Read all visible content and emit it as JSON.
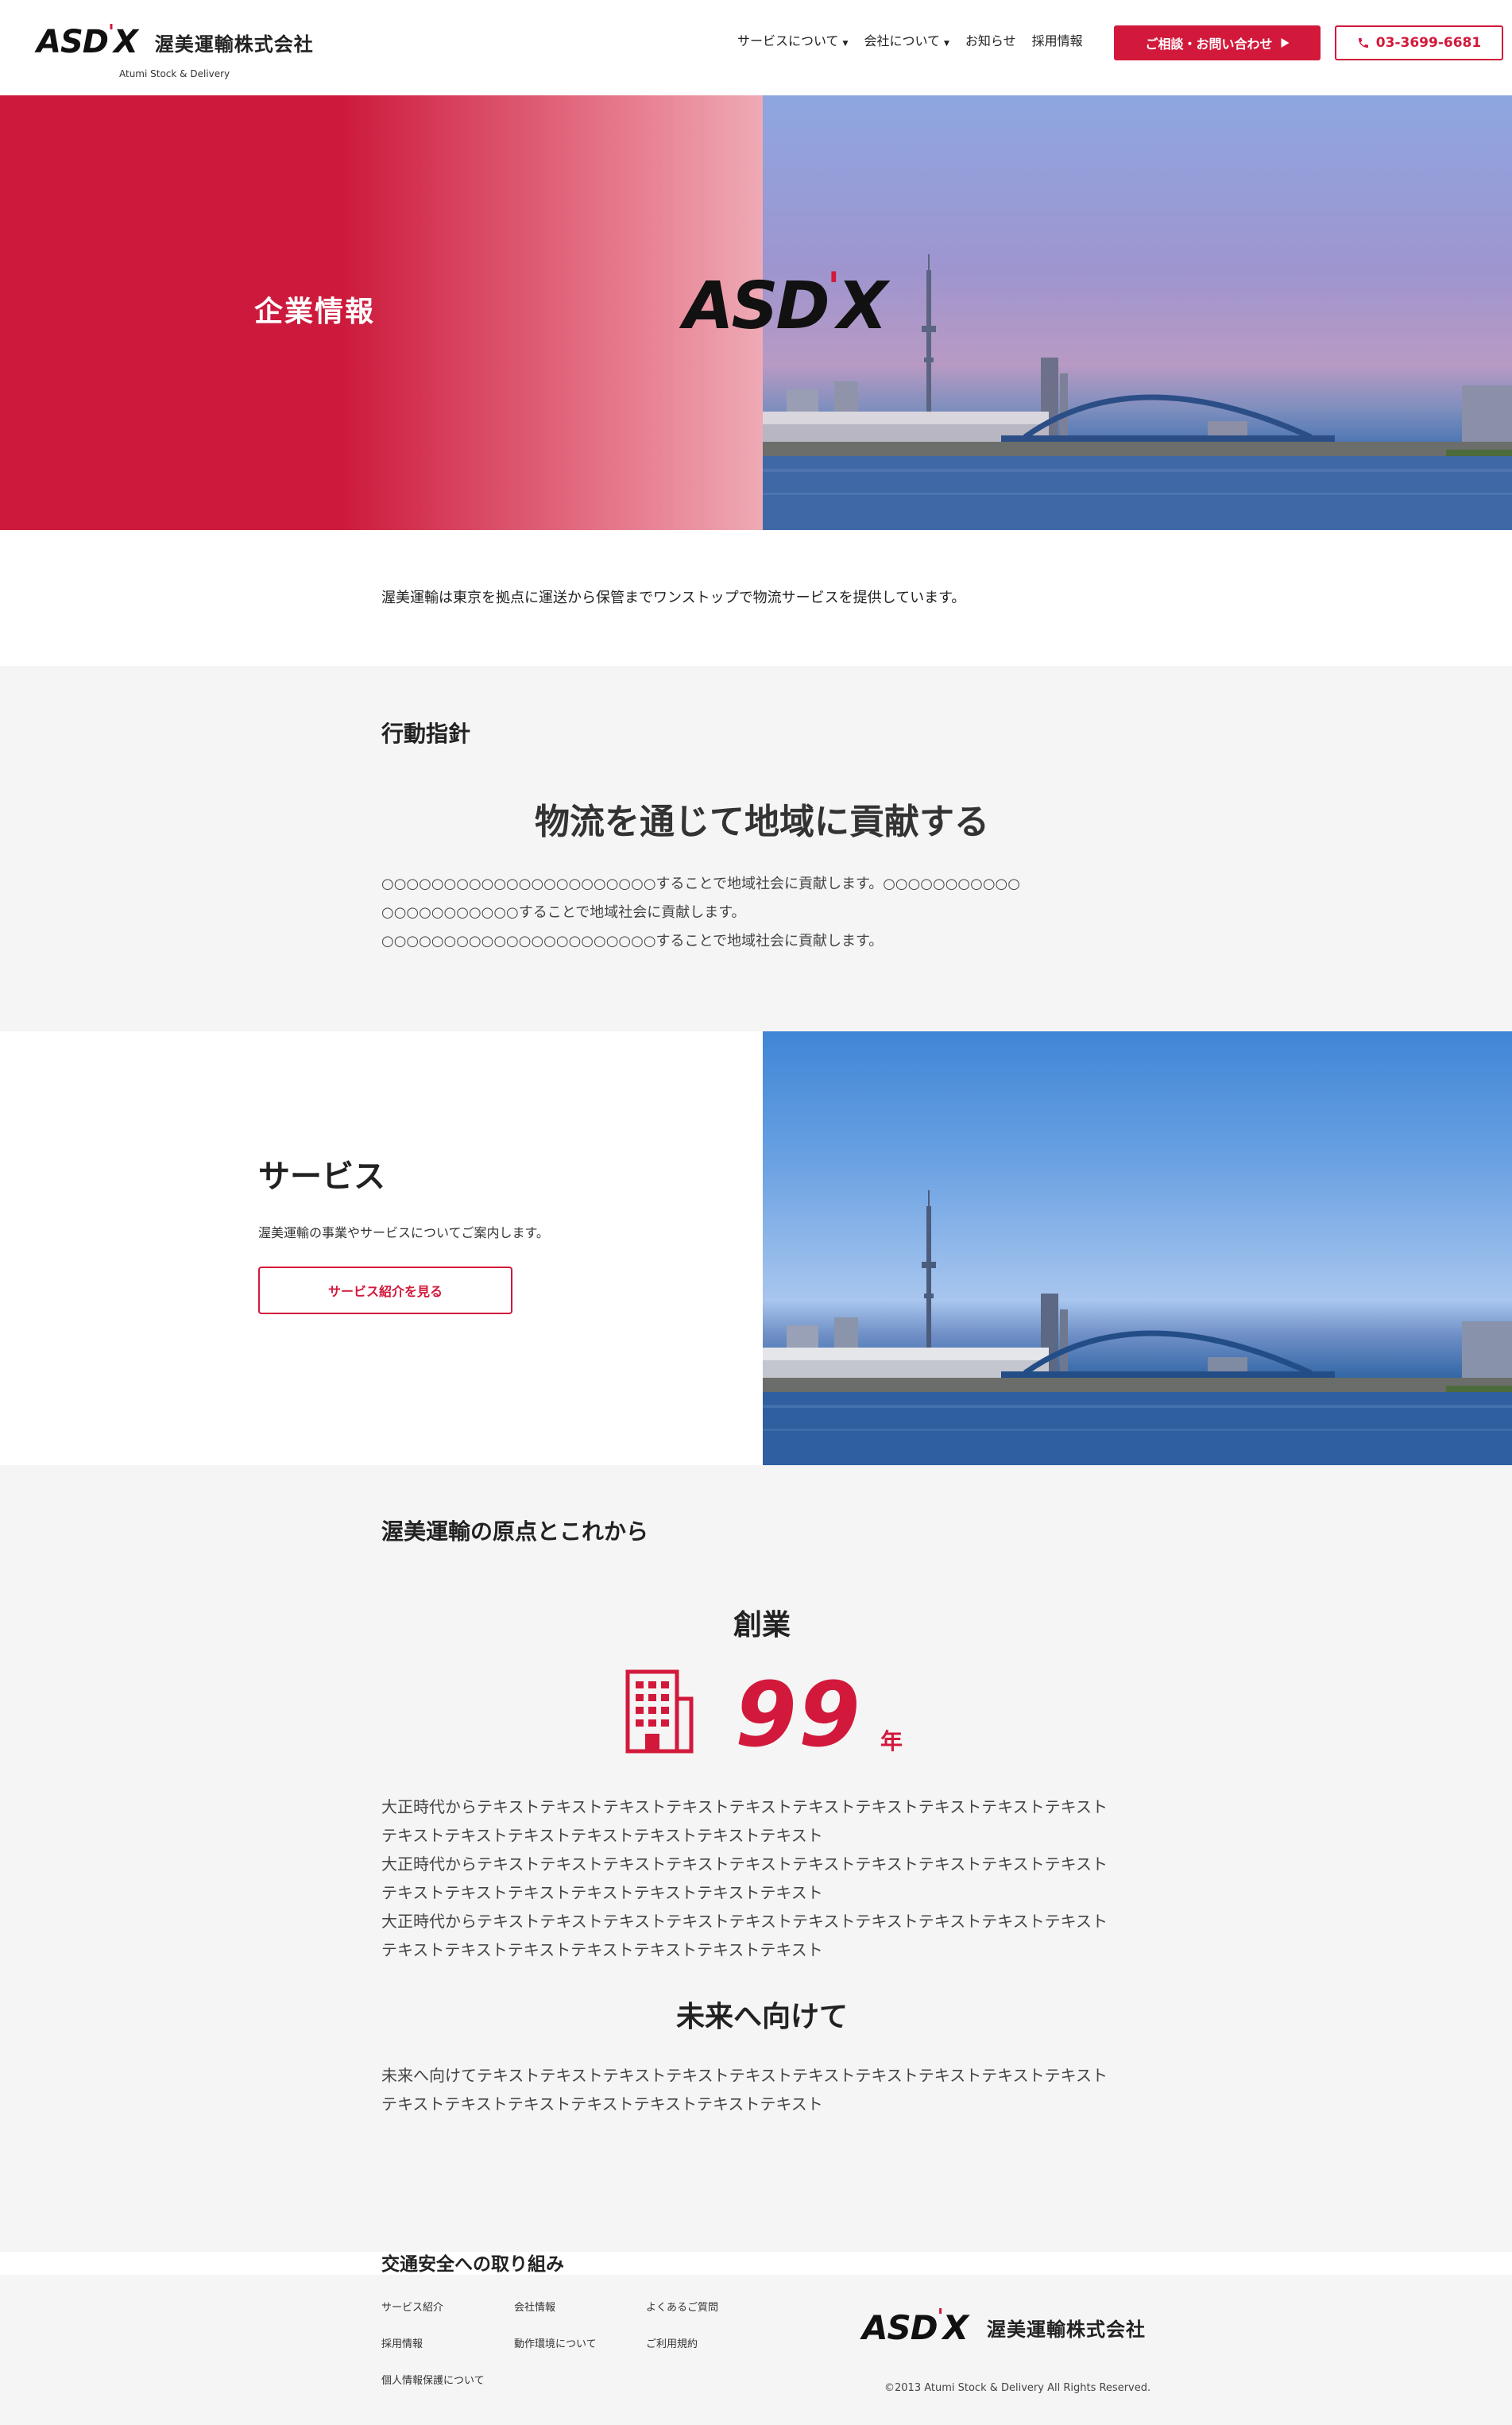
{
  "header": {
    "logo_mark": "ASD",
    "logo_mark_accent": "'",
    "logo_mark_end": "X",
    "company_name": "渥美運輸株式会社",
    "company_sub": "Atumi Stock & Delivery",
    "nav": [
      {
        "label": "サービスについて",
        "dropdown": true
      },
      {
        "label": "会社について",
        "dropdown": true
      },
      {
        "label": "お知らせ",
        "dropdown": false
      },
      {
        "label": "採用情報",
        "dropdown": false
      }
    ],
    "contact_button": "ご相談・お問い合わせ",
    "phone_button": "03-3699-6681"
  },
  "hero": {
    "title": "企業情報",
    "mark": "ASD",
    "mark_accent": "'",
    "mark_end": "X"
  },
  "intro": "渥美運輸は東京を拠点に運送から保管までワンストップで物流サービスを提供しています。",
  "policy": {
    "label": "行動指針",
    "headline": "物流を通じて地域に貢献する",
    "lines": [
      "○○○○○○○○○○○○○○○○○○○○○○することで地域社会に貢献します。○○○○○○○○○○○",
      "○○○○○○○○○○○することで地域社会に貢献します。",
      "○○○○○○○○○○○○○○○○○○○○○○することで地域社会に貢献します。"
    ]
  },
  "service": {
    "title": "サービス",
    "description": "渥美運輸の事業やサービスについてご案内します。",
    "button": "サービス紹介を見る"
  },
  "origin": {
    "label": "渥美運輸の原点とこれから",
    "founding_heading": "創業",
    "years": "99",
    "years_unit": "年",
    "founding_text": [
      "大正時代からテキストテキストテキストテキストテキストテキストテキストテキストテキストテキスト",
      "テキストテキストテキストテキストテキストテキストテキスト",
      "大正時代からテキストテキストテキストテキストテキストテキストテキストテキストテキストテキスト",
      "テキストテキストテキストテキストテキストテキストテキスト",
      "大正時代からテキストテキストテキストテキストテキストテキストテキストテキストテキストテキスト",
      "テキストテキストテキストテキストテキストテキストテキスト"
    ],
    "future_heading": "未来へ向けて",
    "future_text": [
      "未来へ向けてテキストテキストテキストテキストテキストテキストテキストテキストテキストテキスト",
      "テキストテキストテキストテキストテキストテキストテキスト"
    ],
    "safety_label": "交通安全への取り組み"
  },
  "footer": {
    "links": [
      "サービス紹介",
      "会社情報",
      "よくあるご質問",
      "採用情報",
      "動作環境について",
      "ご利用規約",
      "個人情報保護について"
    ],
    "logo_mark": "ASD",
    "logo_mark_accent": "'",
    "logo_mark_end": "X",
    "company_name": "渥美運輸株式会社",
    "copyright": "©2013 Atumi Stock & Delivery All Rights Reserved."
  },
  "colors": {
    "brand_red": "#d2193b",
    "section_gray": "#f5f5f5"
  },
  "icons": [
    "caret-down-icon",
    "play-arrow-icon",
    "phone-icon",
    "building-icon"
  ]
}
